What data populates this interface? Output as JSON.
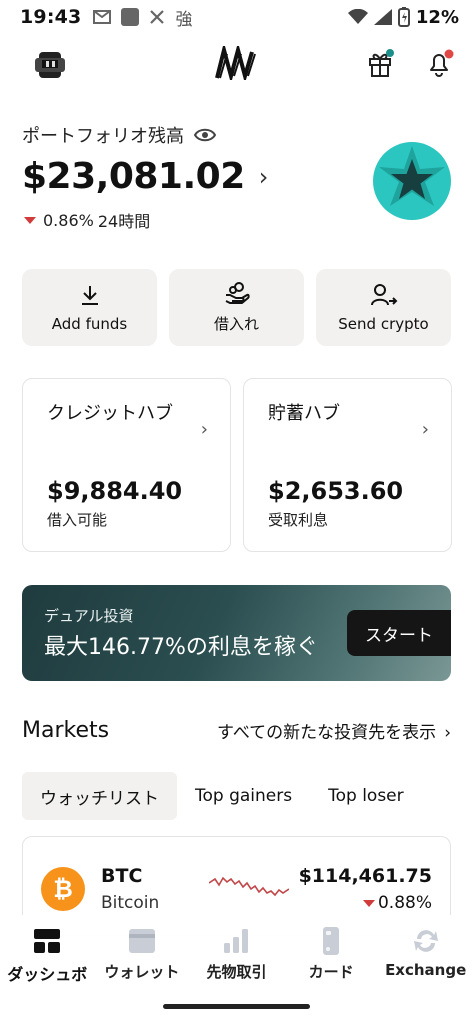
{
  "status_bar": {
    "time": "19:43",
    "notification_glyph": "強",
    "battery_percent": "12%"
  },
  "header": {
    "logo_icon": "nexo-logo-icon",
    "gift_badge_color": "#1d8f8a",
    "bell_badge_color": "#e04848"
  },
  "portfolio": {
    "label": "ポートフォリオ残高",
    "balance": "$23,081.02",
    "change_percent": "0.86%",
    "change_period": "24時間",
    "change_color": "#d23b3b"
  },
  "actions": [
    {
      "label": "Add funds",
      "icon": "download-icon"
    },
    {
      "label": "借入れ",
      "icon": "hand-coins-icon"
    },
    {
      "label": "Send crypto",
      "icon": "user-send-icon"
    }
  ],
  "hubs": [
    {
      "title": "クレジットハブ",
      "amount": "$9,884.40",
      "sub": "借入可能"
    },
    {
      "title": "貯蓄ハブ",
      "amount": "$2,653.60",
      "sub": "受取利息"
    }
  ],
  "banner": {
    "subtitle": "デュアル投資",
    "headline": "最大146.77%の利息を稼ぐ",
    "button": "スタート"
  },
  "markets": {
    "title": "Markets",
    "view_all": "すべての新たな投資先を表示",
    "tabs": [
      "ウォッチリスト",
      "Top gainers",
      "Top loser"
    ],
    "active_tab": 0,
    "assets": [
      {
        "symbol": "BTC",
        "name": "Bitcoin",
        "price": "$114,461.75",
        "change": "0.88%",
        "coin_color": "#f7931a"
      }
    ]
  },
  "bottom_nav": [
    {
      "label": "ダッシュボ",
      "icon": "dashboard-icon",
      "active": true
    },
    {
      "label": "ウォレット",
      "icon": "wallet-icon",
      "active": false
    },
    {
      "label": "先物取引",
      "icon": "futures-chart-icon",
      "active": false
    },
    {
      "label": "カード",
      "icon": "card-icon",
      "active": false
    },
    {
      "label": "Exchange",
      "icon": "exchange-icon",
      "active": false
    }
  ]
}
